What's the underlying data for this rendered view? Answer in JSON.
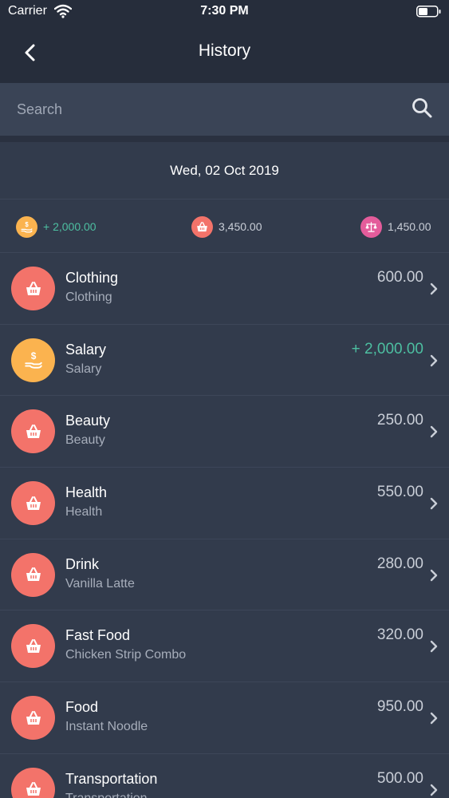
{
  "status": {
    "carrier": "Carrier",
    "time": "7:30 PM"
  },
  "header": {
    "title": "History"
  },
  "search": {
    "placeholder": "Search"
  },
  "date": "Wed, 02 Oct 2019",
  "summary": {
    "income": "+ 2,000.00",
    "expense": "3,450.00",
    "balance": "1,450.00"
  },
  "colors": {
    "expense_icon": "#f3736a",
    "income_icon": "#fbb34f",
    "balance_icon": "#e45c9b",
    "income_text": "#4dbfa1",
    "amount_text": "#c9ced7"
  },
  "transactions": [
    {
      "title": "Clothing",
      "subtitle": "Clothing",
      "amount": "600.00",
      "type": "expense",
      "icon": "basket-icon"
    },
    {
      "title": "Salary",
      "subtitle": "Salary",
      "amount": "+ 2,000.00",
      "type": "income",
      "icon": "hand-dollar-icon"
    },
    {
      "title": "Beauty",
      "subtitle": "Beauty",
      "amount": "250.00",
      "type": "expense",
      "icon": "basket-icon"
    },
    {
      "title": "Health",
      "subtitle": "Health",
      "amount": "550.00",
      "type": "expense",
      "icon": "basket-icon"
    },
    {
      "title": "Drink",
      "subtitle": "Vanilla Latte",
      "amount": "280.00",
      "type": "expense",
      "icon": "basket-icon"
    },
    {
      "title": "Fast Food",
      "subtitle": "Chicken Strip Combo",
      "amount": "320.00",
      "type": "expense",
      "icon": "basket-icon"
    },
    {
      "title": "Food",
      "subtitle": "Instant Noodle",
      "amount": "950.00",
      "type": "expense",
      "icon": "basket-icon"
    },
    {
      "title": "Transportation",
      "subtitle": "Transportation",
      "amount": "500.00",
      "type": "expense",
      "icon": "basket-icon"
    }
  ]
}
